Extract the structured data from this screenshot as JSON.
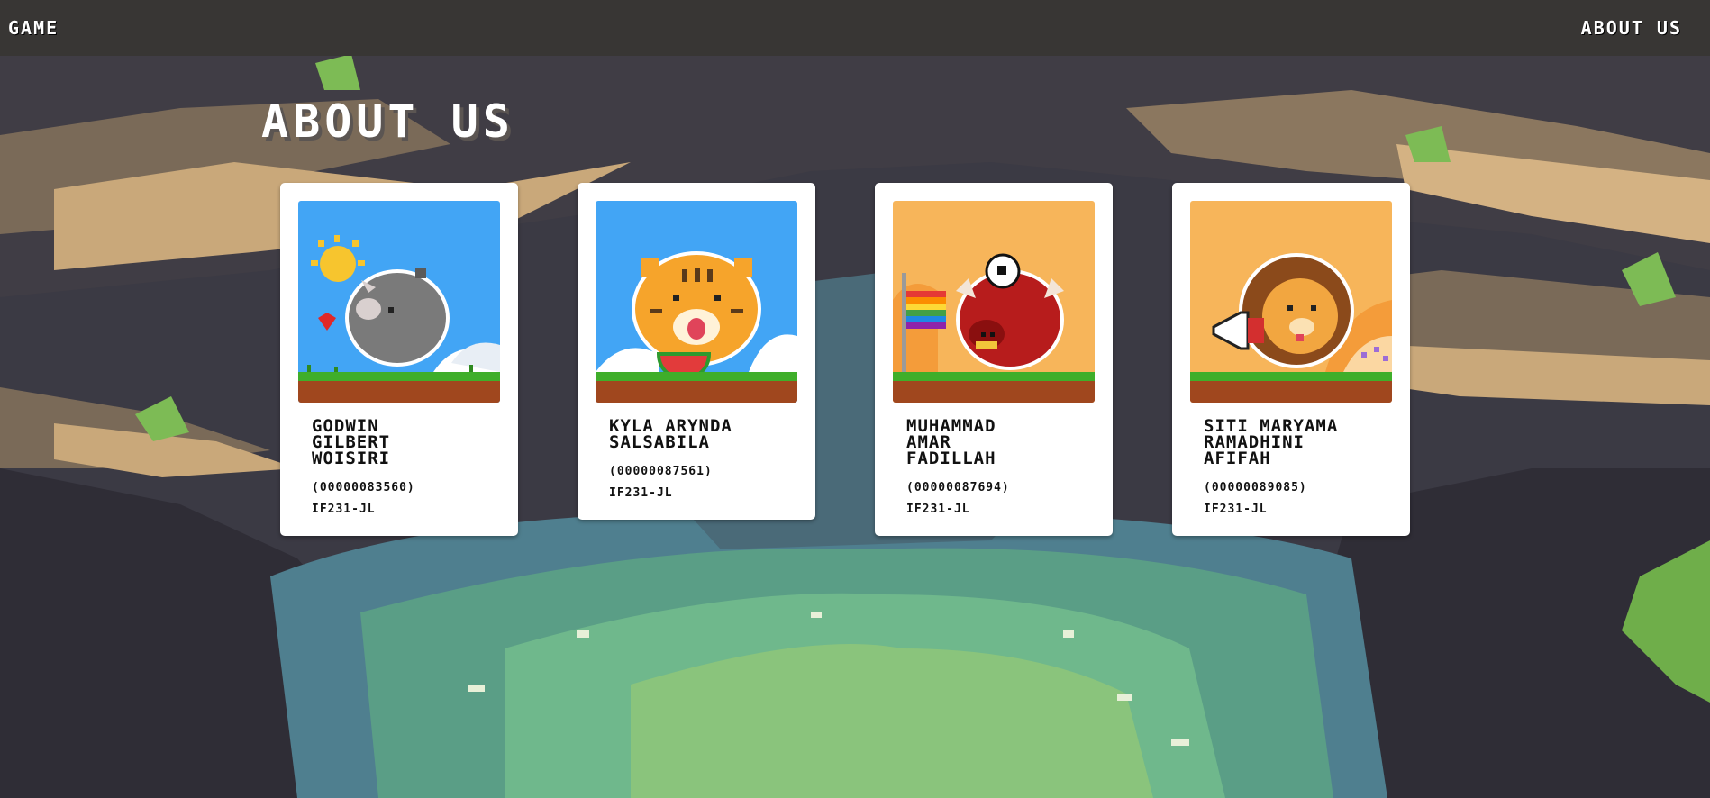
{
  "nav": {
    "home_label": "GAME",
    "about_label": "ABOUT US"
  },
  "page": {
    "title": "ABOUT US"
  },
  "members": [
    {
      "name": "GODWIN GILBERT WOISIRI",
      "nim": "(00000083560)",
      "class": "IF231-JL",
      "animal": "rhino-icon",
      "sky": "#42a5f5"
    },
    {
      "name": "KYLA ARYNDA SALSABILA",
      "nim": "(00000087561)",
      "class": "IF231-JL",
      "animal": "tiger-icon",
      "sky": "#42a5f5"
    },
    {
      "name": "MUHAMMAD AMAR FADILLAH",
      "nim": "(00000087694)",
      "class": "IF231-JL",
      "animal": "bull-icon",
      "sky": "#f7b55a"
    },
    {
      "name": "SITI MARYAMA RAMADHINI AFIFAH",
      "nim": "(00000089085)",
      "class": "IF231-JL",
      "animal": "lion-icon",
      "sky": "#f7b55a"
    }
  ],
  "colors": {
    "navbar": "#383634",
    "card": "#ffffff",
    "grass": "#3fae2a",
    "soil": "#a0471e"
  }
}
